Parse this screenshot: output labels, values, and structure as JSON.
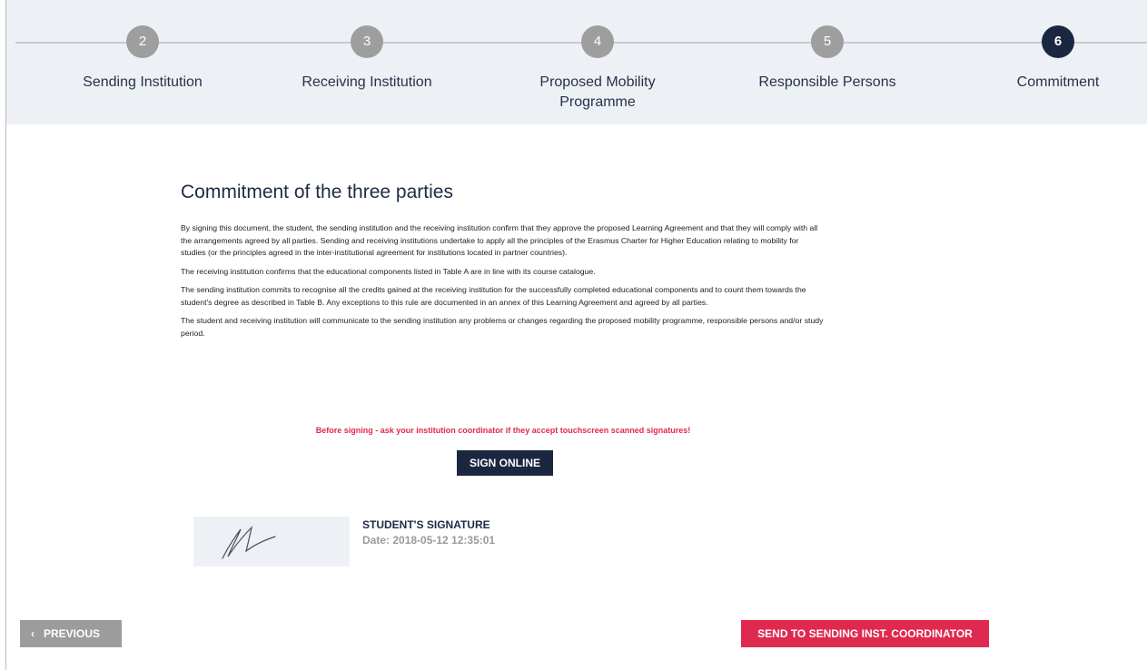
{
  "stepper": {
    "steps": [
      {
        "number": "2",
        "label": "Sending Institution"
      },
      {
        "number": "3",
        "label": "Receiving Institution"
      },
      {
        "number": "4",
        "label": "Proposed Mobility Programme"
      },
      {
        "number": "5",
        "label": "Responsible Persons"
      },
      {
        "number": "6",
        "label": "Commitment"
      }
    ],
    "active_step": "6"
  },
  "commitment": {
    "heading": "Commitment of the three parties",
    "paragraphs": [
      "By signing this document, the student, the sending institution and the receiving institution confirm that they approve the proposed Learning Agreement and that they will comply with all the arrangements agreed by all parties. Sending and receiving institutions undertake to apply all the principles of the Erasmus Charter for Higher Education relating to mobility for studies (or the principles agreed in the inter-institutional agreement for institutions located in partner countries).",
      "The receiving institution confirms that the educational components listed in Table A are in line with its course catalogue.",
      "The sending institution commits to recognise all the credits gained at the receiving institution for the successfully completed educational components and to count them towards the student's degree as described in Table B. Any exceptions to this rule are documented in an annex of this Learning Agreement and agreed by all parties.",
      "The student and receiving institution will communicate to the sending institution any problems or changes regarding the proposed mobility programme, responsible persons and/or study period."
    ],
    "warning": "Before signing - ask your institution coordinator if they accept touchscreen scanned signatures!",
    "sign_button": "SIGN ONLINE"
  },
  "signature": {
    "title": "STUDENT'S SIGNATURE",
    "date": "Date: 2018-05-12 12:35:01"
  },
  "footer": {
    "previous": "PREVIOUS",
    "send": "SEND TO SENDING INST. COORDINATOR"
  },
  "colors": {
    "accent_navy": "#1b2640",
    "accent_red": "#e0294e",
    "inactive_step": "#9e9e9e"
  }
}
